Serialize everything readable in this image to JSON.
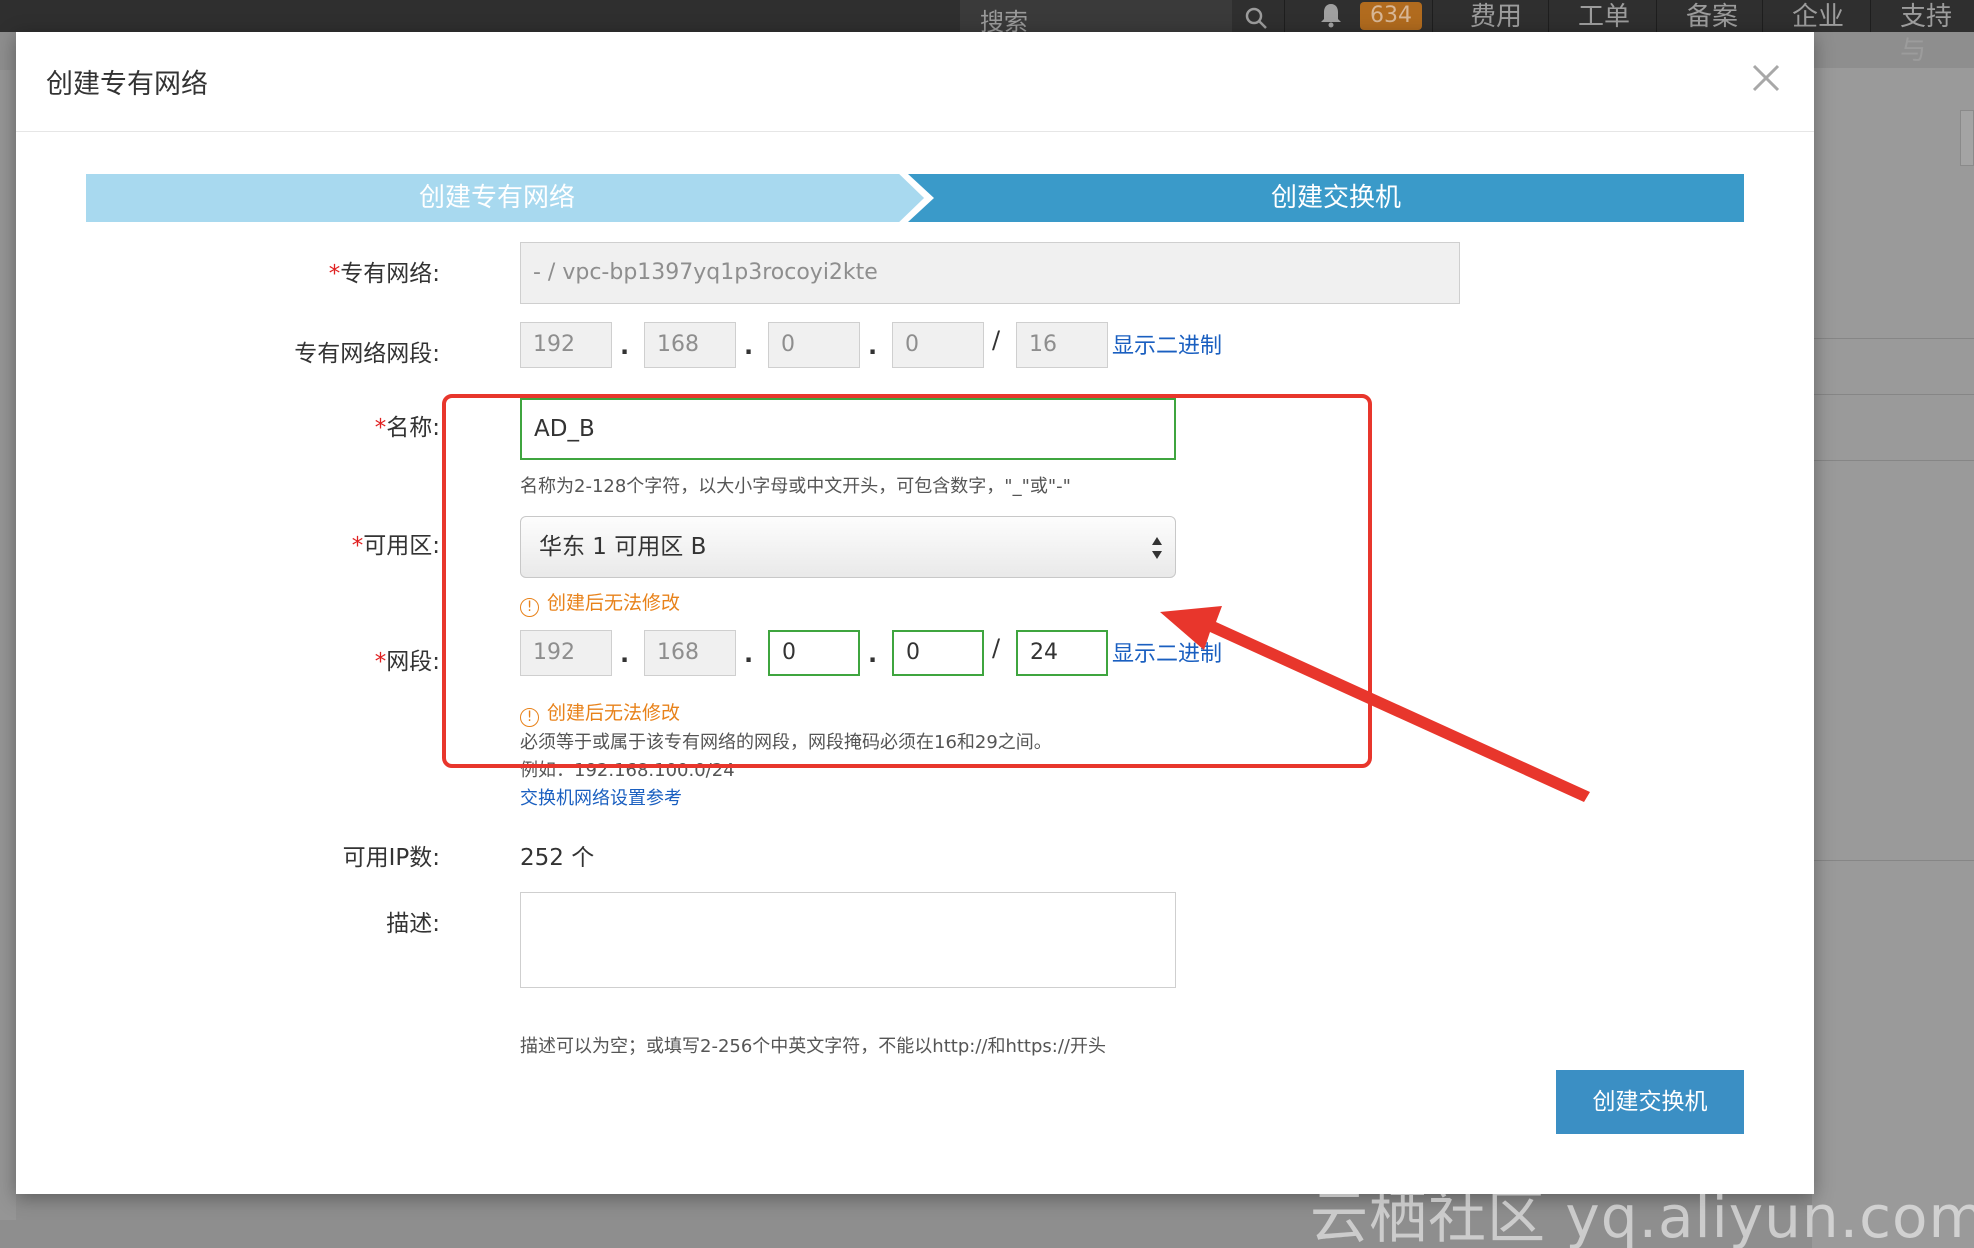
{
  "topbar": {
    "search_placeholder": "搜索",
    "notification_count": "634",
    "nav_items": [
      "费用",
      "工单",
      "备案",
      "企业",
      "支持与"
    ]
  },
  "modal": {
    "title": "创建专有网络",
    "close_icon": "close-icon"
  },
  "steps": [
    {
      "label": "创建专有网络",
      "state": "done"
    },
    {
      "label": "创建交换机",
      "state": "active"
    }
  ],
  "form": {
    "vpc": {
      "label": "专有网络:",
      "required": "*",
      "value": "- / vpc-bp1397yq1p3rocoyi2kte"
    },
    "vpc_cidr": {
      "label": "专有网络网段:",
      "octets": [
        "192",
        "168",
        "0",
        "0"
      ],
      "mask": "16",
      "binary_link": "显示二进制"
    },
    "name": {
      "label": "名称:",
      "required": "*",
      "value": "AD_B",
      "hint": "名称为2-128个字符，以大小字母或中文开头，可包含数字，\"_\"或\"-\""
    },
    "zone": {
      "label": "可用区:",
      "required": "*",
      "value": "华东 1 可用区 B",
      "warning": "创建后无法修改"
    },
    "cidr": {
      "label": "网段:",
      "required": "*",
      "octets": [
        "192",
        "168",
        "0",
        "0"
      ],
      "mask": "24",
      "binary_link": "显示二进制",
      "warning": "创建后无法修改",
      "hint": "必须等于或属于该专有网络的网段，网段掩码必须在16和29之间。",
      "example": "例如：192.168.100.0/24",
      "reference_link": "交换机网络设置参考"
    },
    "available_ip": {
      "label": "可用IP数:",
      "value": "252 个"
    },
    "description": {
      "label": "描述:",
      "value": "",
      "hint": "描述可以为空；或填写2-256个中英文字符，不能以http://和https://开头"
    }
  },
  "actions": {
    "submit": "创建交换机"
  },
  "colors": {
    "step_done": "#a8d9ef",
    "step_active": "#3a9ac9",
    "primary_button": "#3b8fc4",
    "valid_border": "#3fa53f",
    "warning": "#e8821a",
    "annotation_red": "#e8362c",
    "link": "#1a5fc0"
  },
  "watermark": "云栖社区 yq.aliyun.com"
}
